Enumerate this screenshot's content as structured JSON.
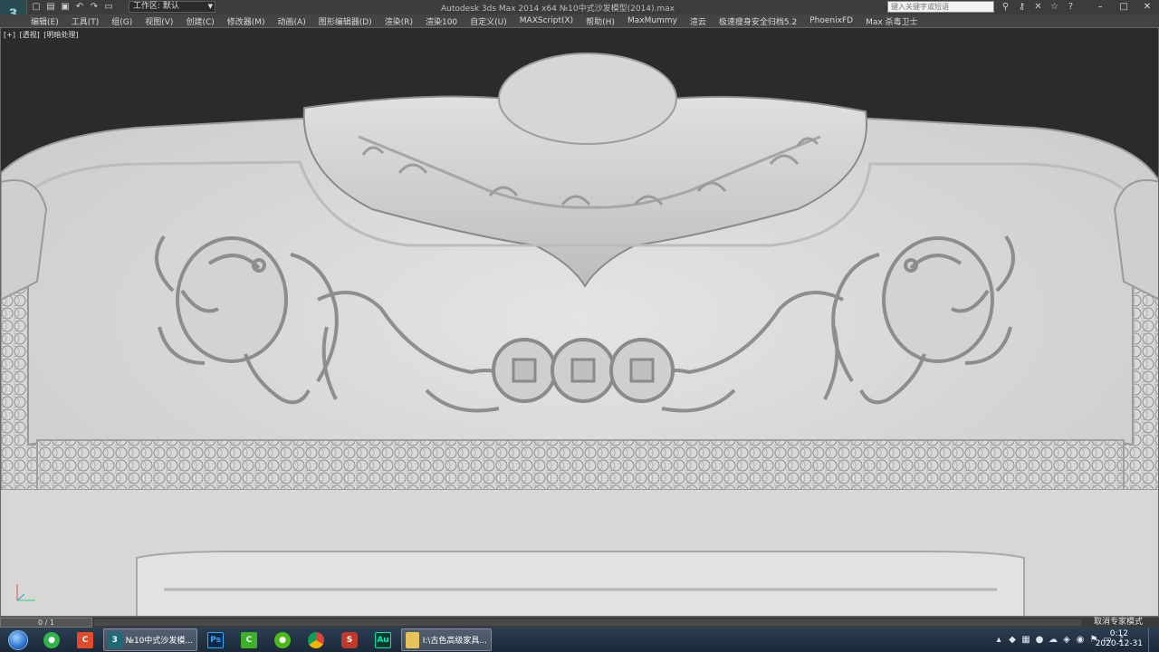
{
  "app": {
    "workspace_label": "工作区: 默认",
    "window_title": "Autodesk 3ds Max  2014 x64      №10中式沙发模型(2014).max",
    "search_placeholder": "键入关键字或短语"
  },
  "menu": [
    "编辑(E)",
    "工具(T)",
    "组(G)",
    "视图(V)",
    "创建(C)",
    "修改器(M)",
    "动画(A)",
    "图形编辑器(D)",
    "渲染(R)",
    "渲染100",
    "自定义(U)",
    "MAXScript(X)",
    "帮助(H)",
    "MaxMummy",
    "渲云",
    "极速瘦身安全归档5.2",
    "PhoenixFD",
    "Max 杀毒卫士"
  ],
  "viewport": {
    "labels": [
      "[+]",
      "[透视]",
      "[明暗处理]"
    ],
    "background_color": "#2b2b2b",
    "model_color": "#d9d9d9"
  },
  "timeline": {
    "frame": "0 / 1",
    "status": "取消专家模式"
  },
  "taskbar": {
    "apps": [
      {
        "name": "wechat",
        "icon": "wechat-icon",
        "label": ""
      },
      {
        "name": "camtasia",
        "icon": "camtasia-icon",
        "label": ""
      },
      {
        "name": "3dsmax",
        "icon": "3dsmax-icon",
        "label": "№10中式沙发模..."
      },
      {
        "name": "photoshop",
        "icon": "photoshop-icon",
        "label": "Ps"
      },
      {
        "name": "camtasia2",
        "icon": "camtasia-recorder-icon",
        "label": ""
      },
      {
        "name": "360",
        "icon": "360-icon",
        "label": ""
      },
      {
        "name": "chrome",
        "icon": "chrome-icon",
        "label": ""
      },
      {
        "name": "sketchup",
        "icon": "sketchup-icon",
        "label": ""
      },
      {
        "name": "audition",
        "icon": "audition-icon",
        "label": "Au"
      },
      {
        "name": "explorer",
        "icon": "folder-icon",
        "label": "I:\\古色高级家具..."
      }
    ],
    "clock_time": "0:12",
    "clock_date": "2020-12-31"
  }
}
